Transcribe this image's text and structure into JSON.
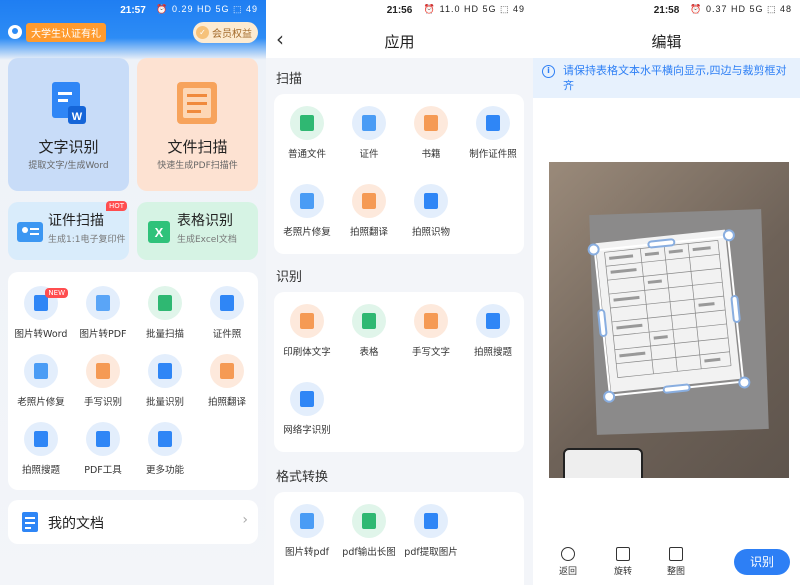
{
  "home": {
    "status": {
      "time": "21:57",
      "icons": "⏰ 0.29 HD 5G ⬚ 49"
    },
    "promo_tag": "大学生认证有礼",
    "vip_label": "会员权益",
    "big_cards": [
      {
        "title": "文字识别",
        "sub": "提取文字/生成Word"
      },
      {
        "title": "文件扫描",
        "sub": "快速生成PDF扫描件"
      }
    ],
    "mid_cards": [
      {
        "title": "证件扫描",
        "sub": "生成1:1电子复印件",
        "badge": "HOT"
      },
      {
        "title": "表格识别",
        "sub": "生成Excel文档"
      }
    ],
    "grid_items": [
      {
        "label": "图片转Word",
        "badge": "NEW"
      },
      {
        "label": "图片转PDF"
      },
      {
        "label": "批量扫描"
      },
      {
        "label": "证件照"
      },
      {
        "label": "老照片修复"
      },
      {
        "label": "手写识别"
      },
      {
        "label": "批量识别"
      },
      {
        "label": "拍照翻译"
      },
      {
        "label": "拍照搜题"
      },
      {
        "label": "PDF工具"
      },
      {
        "label": "更多功能"
      }
    ],
    "my_docs": "我的文档"
  },
  "apps": {
    "status": {
      "time": "21:56",
      "icons": "⏰ 11.0 HD 5G ⬚ 49"
    },
    "title": "应用",
    "sections": [
      {
        "title": "扫描",
        "items": [
          "普通文件",
          "证件",
          "书籍",
          "制作证件照",
          "老照片修复",
          "拍照翻译",
          "拍照识物"
        ]
      },
      {
        "title": "识别",
        "items": [
          "印刷体文字",
          "表格",
          "手写文字",
          "拍照搜题",
          "网络字识别"
        ]
      },
      {
        "title": "格式转换",
        "items": [
          "图片转pdf",
          "pdf输出长图",
          "pdf提取图片"
        ]
      }
    ]
  },
  "edit": {
    "status": {
      "time": "21:58",
      "icons": "⏰ 0.37 HD 5G ⬚ 48"
    },
    "title": "编辑",
    "hint": "请保持表格文本水平横向显示,四边与裁剪框对齐",
    "toolbar": {
      "back": "返回",
      "rotate": "旋转",
      "full": "整图",
      "recognize": "识别"
    }
  },
  "colors": {
    "accent": "#2d7ff5",
    "hot": "#ff4d4f"
  }
}
